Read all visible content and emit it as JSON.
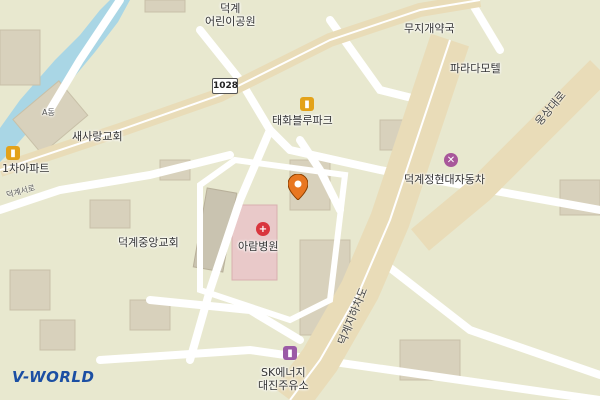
{
  "map": {
    "labels": {
      "park_line1": "덕계",
      "park_line2": "어린이공원",
      "pharmacy": "무지개약국",
      "motel": "파라다모텔",
      "taehwa": "태화블루파크",
      "church_sarang": "새사랑교회",
      "apartment": "1차아파트",
      "building_a": "A동",
      "carshop": "덕계정현대자동차",
      "hospital": "아람병원",
      "church_central": "덕계중앙교회",
      "gas_line1": "SK에너지",
      "gas_line2": "대진주유소"
    },
    "roads": {
      "route_number": "1028",
      "woongsang": "웅상대로",
      "underpass": "덕계지하차도",
      "deokgye_seoro": "덕계서로"
    },
    "icons": [
      "apartment-icon",
      "carshop-icon",
      "hospital-icon",
      "gas-station-icon",
      "location-pin-icon"
    ],
    "colors": {
      "background": "#e8e8cf",
      "road": "#ffffff",
      "major_road": "#e9dcb8",
      "water": "#a9d6e5",
      "building": "#d6cfbd",
      "hospital_area": "#e9c9c9",
      "pin": "#e87722",
      "logo": "#1c4fa3"
    },
    "logo": "V-WORLD"
  }
}
